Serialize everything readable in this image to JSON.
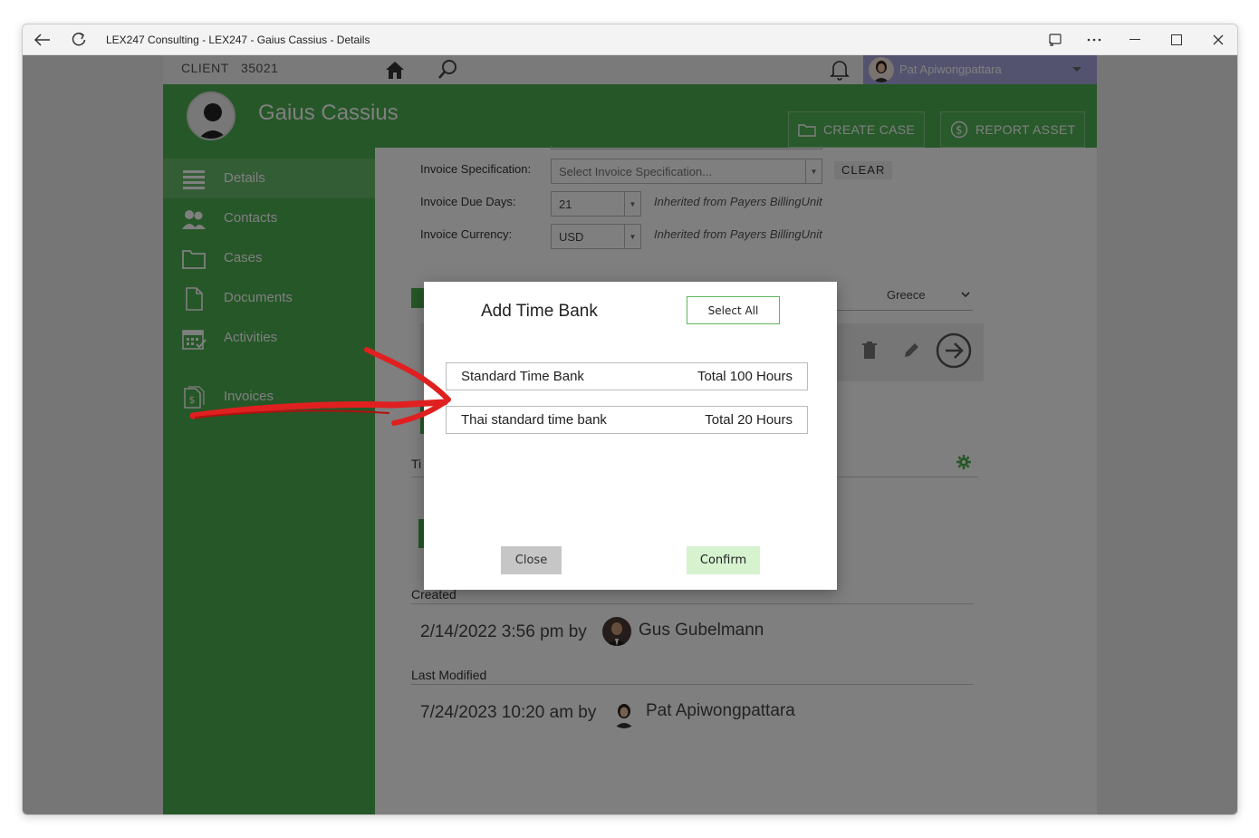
{
  "window": {
    "title": "LEX247 Consulting - LEX247 - Gaius Cassius - Details"
  },
  "topbar": {
    "client_label": "CLIENT",
    "client_number": "35021",
    "user_name": "Pat Apiwongpattara"
  },
  "header": {
    "client_name": "Gaius Cassius",
    "create_case_label": "CREATE CASE",
    "report_asset_label": "REPORT ASSET"
  },
  "sidebar": {
    "items": [
      {
        "label": "Details",
        "icon": "list-icon"
      },
      {
        "label": "Contacts",
        "icon": "people-icon"
      },
      {
        "label": "Cases",
        "icon": "folder-icon"
      },
      {
        "label": "Documents",
        "icon": "document-icon"
      },
      {
        "label": "Activities",
        "icon": "calendar-icon"
      },
      {
        "label": "Invoices",
        "icon": "invoice-icon"
      }
    ]
  },
  "main": {
    "invoice_spec_label": "Invoice Specification:",
    "invoice_spec_placeholder": "Select Invoice Specification...",
    "clear_label": "CLEAR",
    "due_days_label": "Invoice Due Days:",
    "due_days_value": "21",
    "due_days_note": "Inherited from Payers BillingUnit",
    "currency_label": "Invoice Currency:",
    "currency_value": "USD",
    "currency_note": "Inherited from Payers BillingUnit",
    "country_value": "Greece",
    "timebank_section_prefix": "Ti",
    "created_label": "Created",
    "created_text": "2/14/2022 3:56 pm by",
    "created_user": "Gus Gubelmann",
    "modified_label": "Last Modified",
    "modified_text": "7/24/2023 10:20 am by",
    "modified_user": "Pat Apiwongpattara"
  },
  "modal": {
    "title": "Add Time Bank",
    "select_all_label": "Select All",
    "items": [
      {
        "name": "Standard Time Bank",
        "hours": "Total 100 Hours"
      },
      {
        "name": "Thai standard time bank",
        "hours": "Total 20 Hours"
      }
    ],
    "close_label": "Close",
    "confirm_label": "Confirm"
  },
  "colors": {
    "green": "#4caf50",
    "annotation_red": "#e02020"
  }
}
